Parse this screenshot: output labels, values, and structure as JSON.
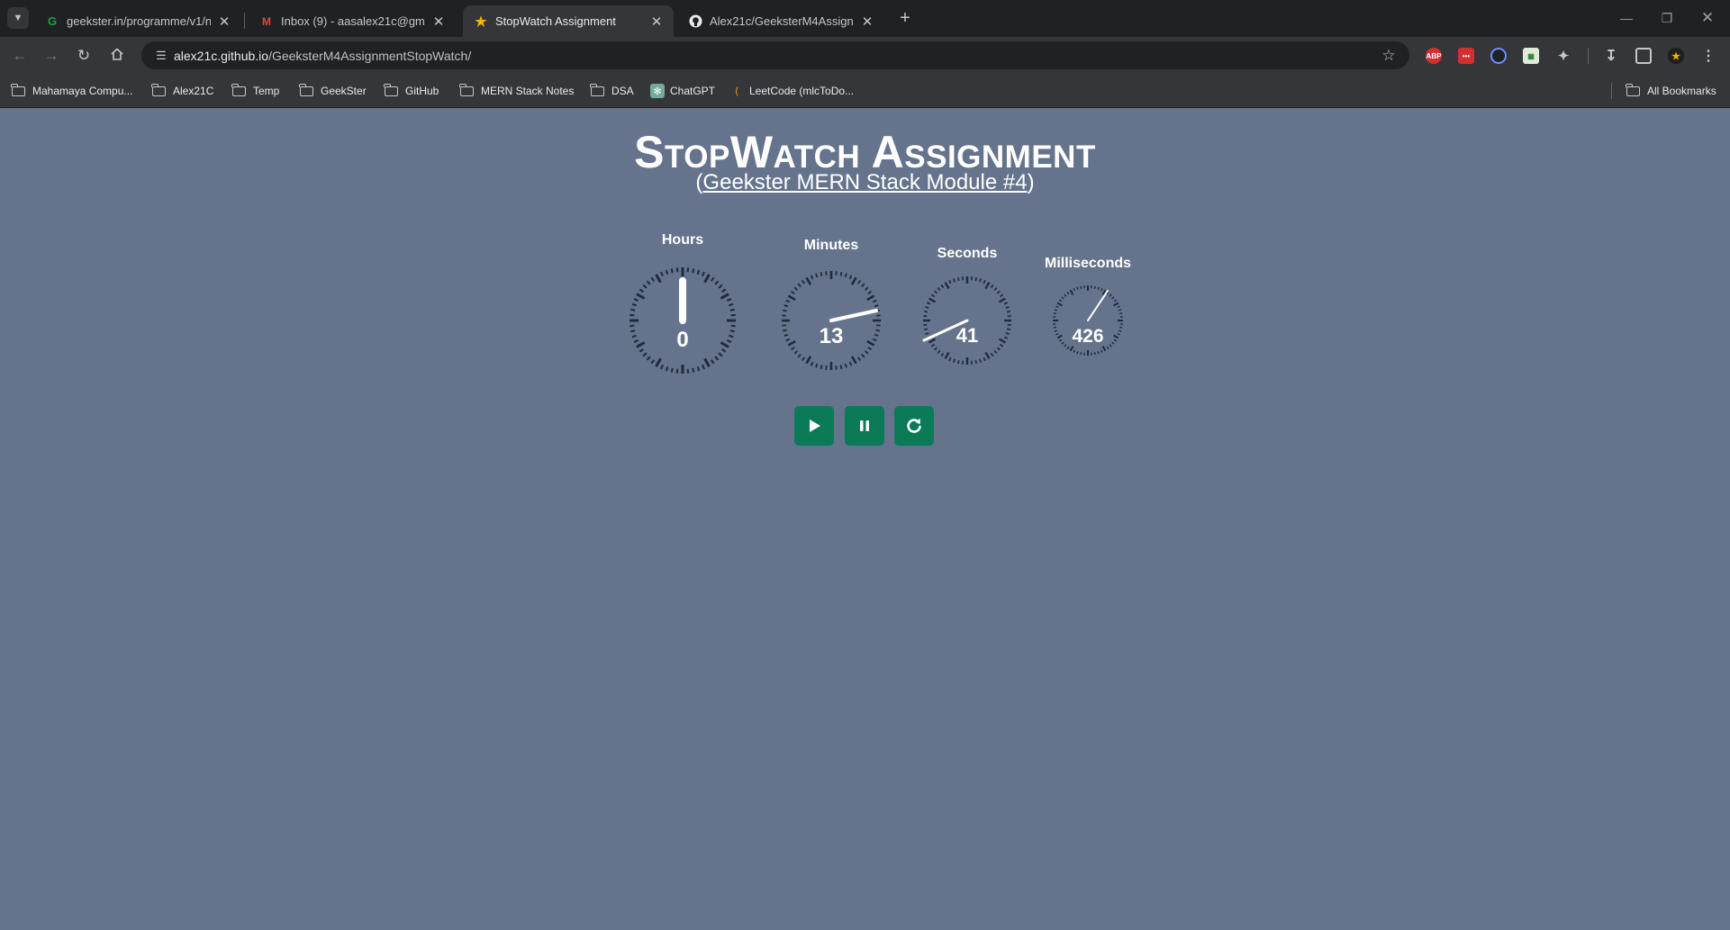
{
  "browser": {
    "tabs": [
      {
        "title": "geekster.in/programme/v1/new",
        "favicon": "geekster-logo-icon",
        "active": false
      },
      {
        "title": "Inbox (9) - aasalex21c@gmail.com",
        "favicon": "gmail-icon",
        "active": false
      },
      {
        "title": "StopWatch Assignment",
        "favicon": "star-icon",
        "active": true
      },
      {
        "title": "Alex21c/GeeksterM4Assignment",
        "favicon": "github-icon",
        "active": false
      }
    ],
    "address": {
      "host": "alex21c.github.io",
      "path": "/GeeksterM4AssignmentStopWatch/"
    },
    "bookmarks": [
      {
        "label": "Mahamaya Compu...",
        "icon": "folder-icon"
      },
      {
        "label": "Alex21C",
        "icon": "folder-icon"
      },
      {
        "label": "Temp",
        "icon": "folder-icon"
      },
      {
        "label": "GeekSter",
        "icon": "folder-icon"
      },
      {
        "label": "GitHub",
        "icon": "folder-icon"
      },
      {
        "label": "MERN Stack Notes",
        "icon": "folder-icon"
      },
      {
        "label": "DSA",
        "icon": "folder-icon"
      },
      {
        "label": "ChatGPT",
        "icon": "chatgpt-icon"
      },
      {
        "label": "LeetCode (mlcToDo...",
        "icon": "leetcode-icon"
      }
    ],
    "all_bookmarks": "All Bookmarks"
  },
  "page": {
    "title": "StopWatch Assignment",
    "subtitle_open": "(",
    "subtitle_link": "Geekster MERN Stack Module #4",
    "subtitle_close": ")"
  },
  "stopwatch": {
    "hours": {
      "label": "Hours",
      "value": "0"
    },
    "minutes": {
      "label": "Minutes",
      "value": "13"
    },
    "seconds": {
      "label": "Seconds",
      "value": "41"
    },
    "milliseconds": {
      "label": "Milliseconds",
      "value": "426"
    }
  },
  "controls": {
    "start": "play-icon",
    "pause": "pause-icon",
    "reset": "reset-icon",
    "color": "#0a7a57"
  },
  "colors": {
    "background": "#65748c",
    "dial_ticks": "#202a3b",
    "hand": "#ffffff"
  }
}
